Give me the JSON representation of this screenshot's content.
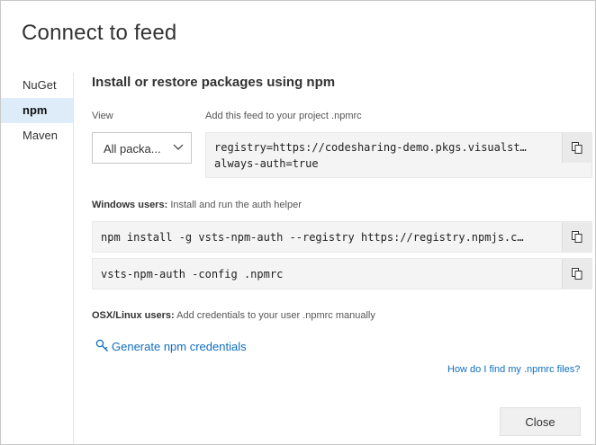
{
  "dialog": {
    "title": "Connect to feed",
    "close_label": "Close"
  },
  "sidebar": {
    "items": [
      {
        "label": "NuGet"
      },
      {
        "label": "npm",
        "active": true
      },
      {
        "label": "Maven"
      }
    ]
  },
  "main": {
    "heading": "Install or restore packages using npm",
    "view_label": "View",
    "view_selected": "All packa...",
    "npmrc_label": "Add this feed to your project .npmrc",
    "npmrc_line1": "registry=https://codesharing-demo.pkgs.visualst…",
    "npmrc_line2": "always-auth=true",
    "windows_label_bold": "Windows users:",
    "windows_label_text": "Install and run the auth helper",
    "cmd_install": "npm install -g vsts-npm-auth --registry https://registry.npmjs.c…",
    "cmd_config": "vsts-npm-auth -config .npmrc",
    "osx_label_bold": "OSX/Linux users:",
    "osx_label_text": "Add credentials to your user .npmrc manually",
    "generate_link": "Generate npm credentials",
    "help_link": "How do I find my .npmrc files?"
  },
  "icons": {
    "copy": "copy-icon",
    "chevron": "chevron-down-icon",
    "key": "key-icon"
  },
  "colors": {
    "accent": "#106ebe",
    "active_bg": "#deecf9",
    "code_bg": "#f4f4f4"
  }
}
